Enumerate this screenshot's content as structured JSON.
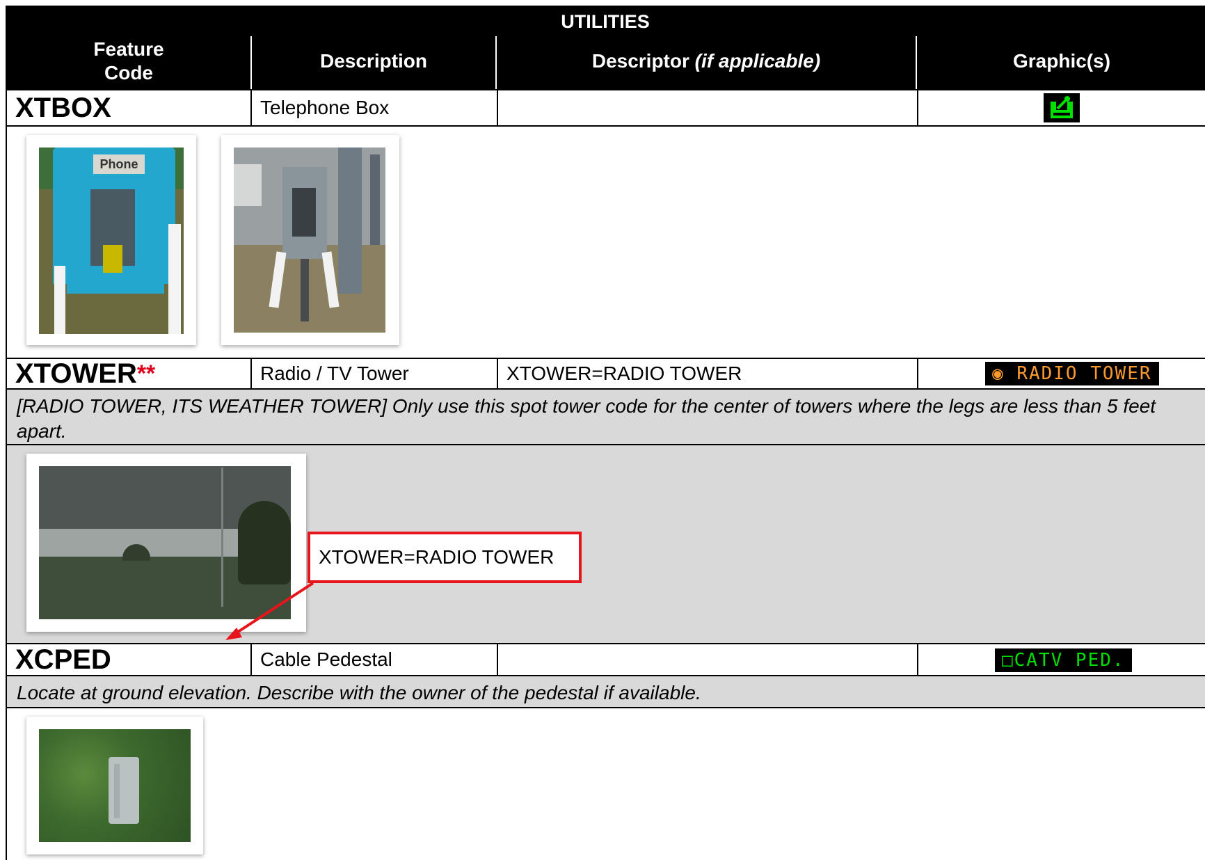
{
  "table": {
    "title": "UTILITIES",
    "headers": {
      "feature_code": "Feature Code",
      "description": "Description",
      "descriptor": "Descriptor",
      "descriptor_note": "(if applicable)",
      "graphics": "Graphic(s)"
    }
  },
  "features": [
    {
      "code": "XTBOX",
      "description": "Telephone Box",
      "descriptor": "",
      "graphic": {
        "icon": "telephone-handset-icon",
        "color": "#00e000"
      },
      "photos": [
        "blue-phone-booth-photo",
        "grey-phone-booth-photo"
      ]
    },
    {
      "code": "XTOWER",
      "stars": "**",
      "description": "Radio / TV Tower",
      "descriptor": "XTOWER=RADIO TOWER",
      "graphic": {
        "label": "RADIO TOWER",
        "icon": "target-circle-icon",
        "color": "#ff9a2e"
      },
      "note": "[RADIO TOWER, ITS WEATHER TOWER] Only use this spot tower code for the center of towers where the legs are less than 5 feet apart.",
      "callout": "XTOWER=RADIO TOWER",
      "photos": [
        "radio-tower-field-photo"
      ]
    },
    {
      "code": "XCPED",
      "description": "Cable Pedestal",
      "descriptor": "",
      "graphic": {
        "label": "CATV PED.",
        "icon": "square-icon",
        "color": "#00e000"
      },
      "note": "Locate at ground elevation. Describe with the owner of the pedestal if available.",
      "photos": [
        "cable-pedestal-grass-photo"
      ]
    }
  ],
  "colors": {
    "header_bg": "#000000",
    "note_bg": "#d9d9d9",
    "callout_border": "#e8141b",
    "stars": "#e0001b"
  }
}
